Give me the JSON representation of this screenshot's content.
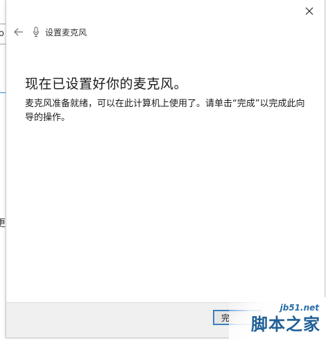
{
  "background_window": {
    "input_fragment": "o",
    "side_char": "更"
  },
  "nav": {
    "title": "设置麦克风"
  },
  "content": {
    "heading": "现在已设置好你的麦克风。",
    "description": "麦克风准备就绪，可以在此计算机上使用了。请单击“完成”以完成此向导的操作。"
  },
  "footer": {
    "finish_label": "完"
  },
  "watermark": {
    "url": "jb51.net",
    "text": "脚本之家"
  },
  "colors": {
    "accent": "#3c7fc2",
    "footer_bg": "#f0f0f0"
  },
  "icons": {
    "close": "close-icon",
    "back": "back-arrow-icon",
    "mic": "microphone-icon"
  }
}
